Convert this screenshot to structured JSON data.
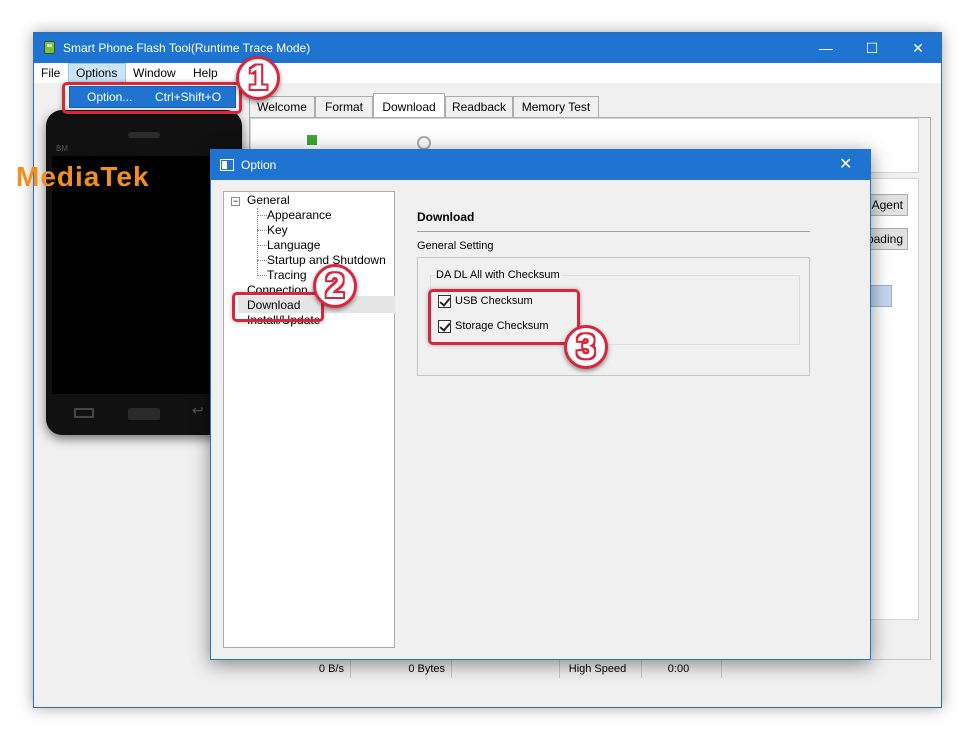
{
  "window": {
    "title": "Smart Phone Flash Tool(Runtime Trace Mode)",
    "minimize": "—",
    "maximize": "☐",
    "close": "✕"
  },
  "menubar": {
    "items": [
      "File",
      "Options",
      "Window",
      "Help"
    ]
  },
  "options_dropdown": {
    "item_label": "Option...",
    "shortcut": "Ctrl+Shift+O"
  },
  "phone": {
    "model_text": "BM",
    "brand": "MediaTek"
  },
  "tabs": [
    {
      "label": "Welcome",
      "active": false
    },
    {
      "label": "Format",
      "active": false
    },
    {
      "label": "Download",
      "active": true
    },
    {
      "label": "Readback",
      "active": false
    },
    {
      "label": "Memory Test",
      "active": false
    }
  ],
  "side_buttons": {
    "agent": "d Agent",
    "loading": "oading"
  },
  "status_bar": {
    "speed": "0 B/s",
    "bytes": "0 Bytes",
    "mode": "High Speed",
    "time": "0:00"
  },
  "option_dialog": {
    "title": "Option",
    "close": "✕",
    "tree": {
      "root": "General",
      "expander": "−",
      "children": [
        "Appearance",
        "Key",
        "Language",
        "Startup and Shutdown",
        "Tracing"
      ],
      "connection": "Connection",
      "download": "Download",
      "install_update": "Install/Update"
    },
    "content": {
      "title": "Download",
      "section": "General Setting",
      "group_title": "DA DL All with Checksum",
      "usb_checksum": {
        "label": "USB Checksum",
        "checked": true
      },
      "storage_checksum": {
        "label": "Storage Checksum",
        "checked": true
      }
    }
  },
  "callouts": [
    "1",
    "2",
    "3"
  ],
  "colors": {
    "titlebar": "#1f74d2",
    "callout": "#d7263d",
    "brand_orange": "#f2901d"
  }
}
